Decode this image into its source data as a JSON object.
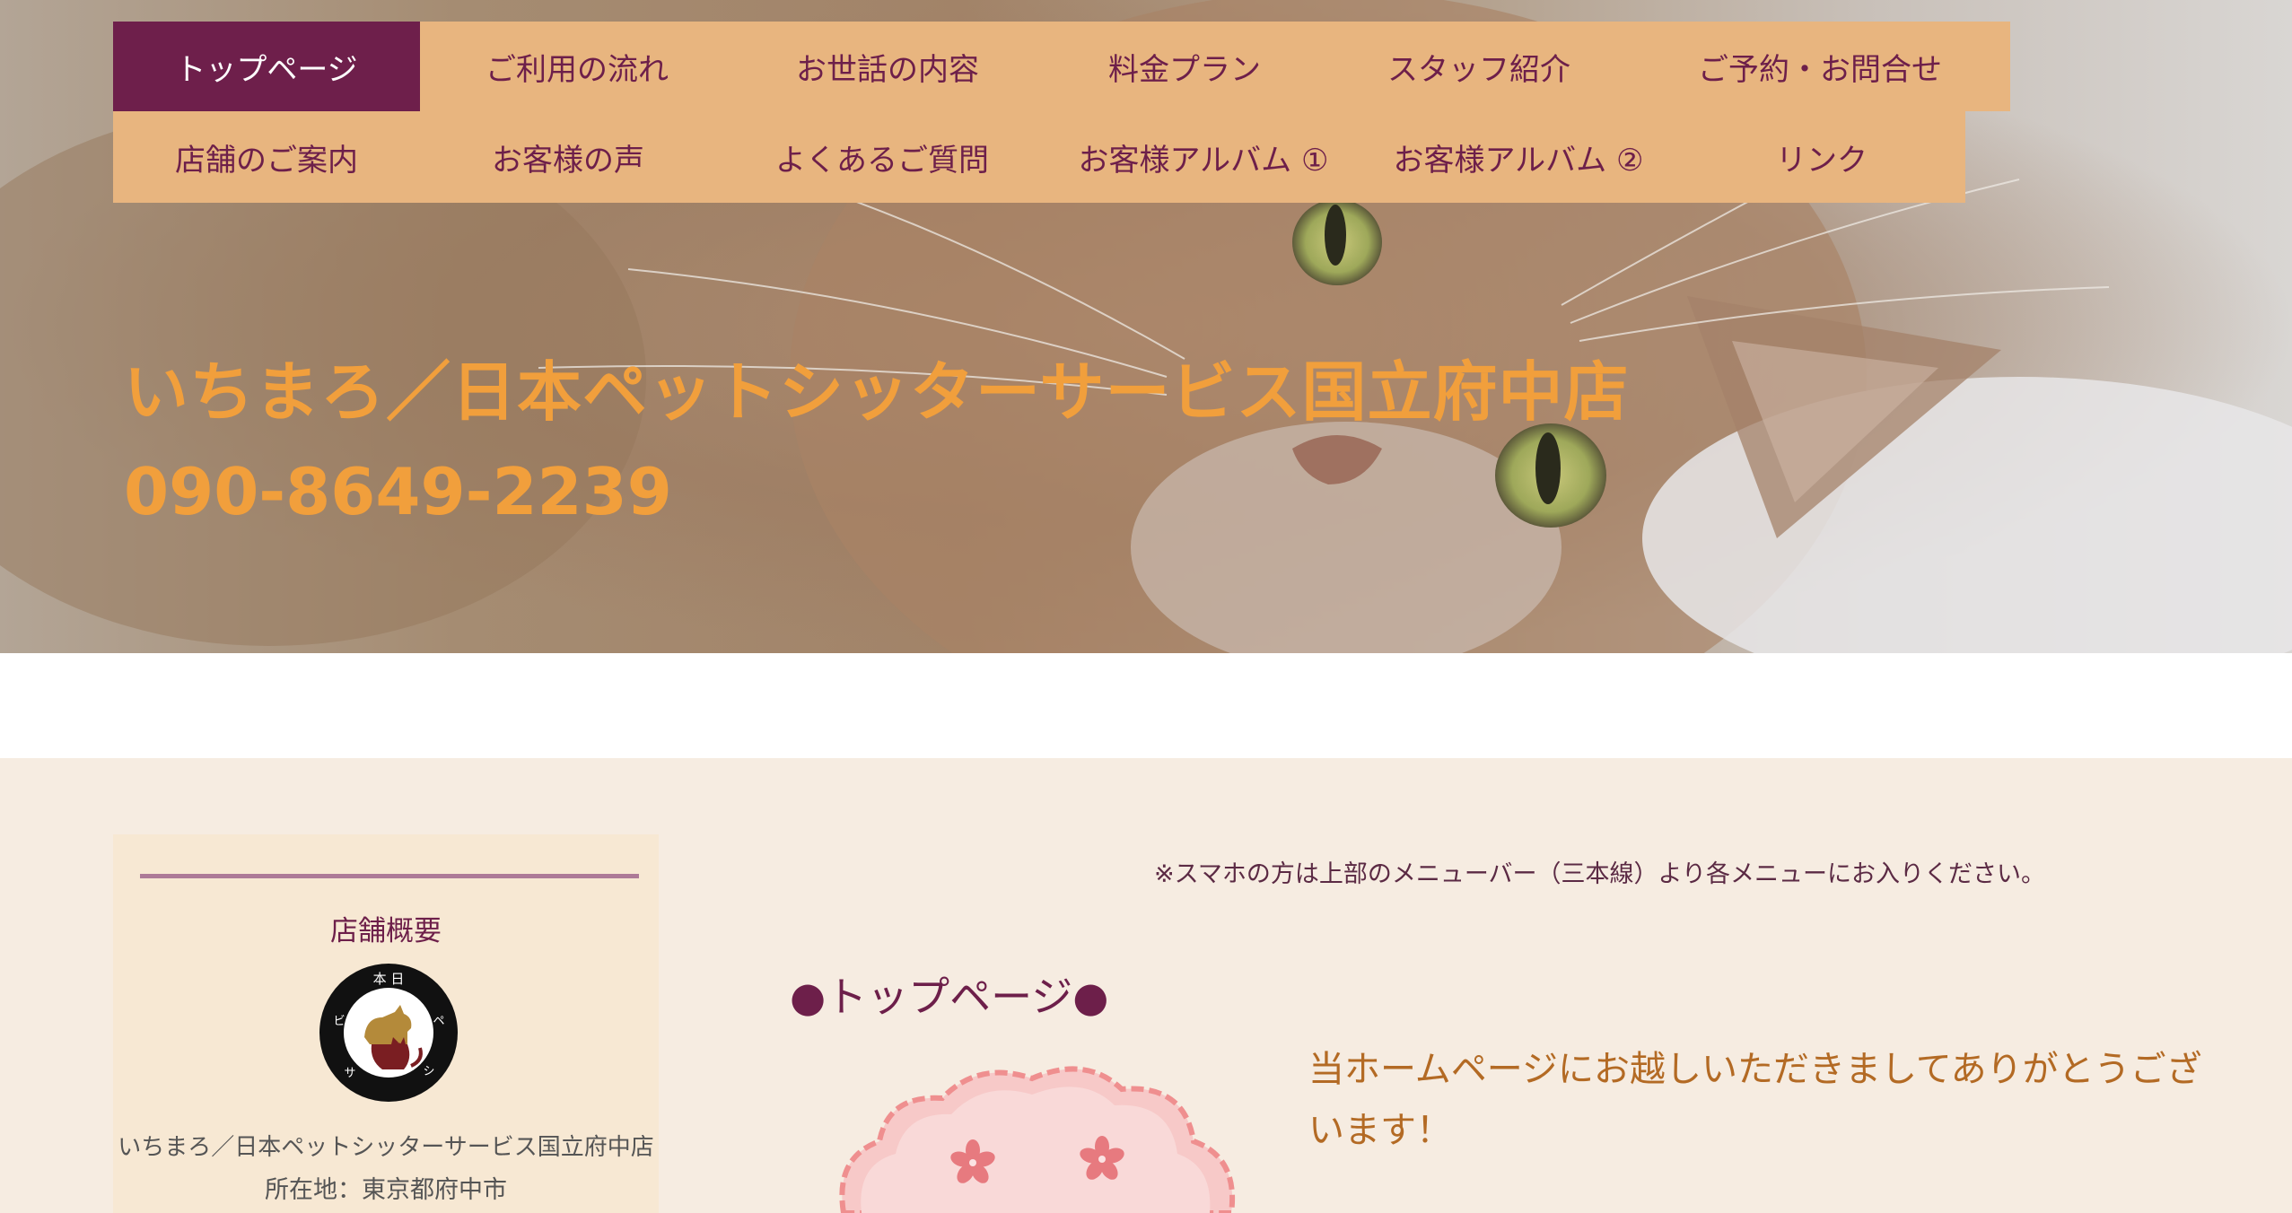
{
  "colors": {
    "nav_bg": "#e8b57f",
    "nav_active_bg": "#6e1f4b",
    "nav_text": "#6d1f4a",
    "title_orange": "#f19f3c",
    "content_bg": "#f6ece1",
    "sidebar_bg": "#f7e8d3",
    "welcome_text": "#b36a24"
  },
  "nav": {
    "row1": [
      {
        "label": "トップページ",
        "active": true
      },
      {
        "label": "ご利用の流れ"
      },
      {
        "label": "お世話の内容"
      },
      {
        "label": "料金プラン"
      },
      {
        "label": "スタッフ紹介"
      },
      {
        "label": "ご予約・お問合せ"
      }
    ],
    "row2": [
      {
        "label": "店舗のご案内"
      },
      {
        "label": "お客様の声"
      },
      {
        "label": "よくあるご質問"
      },
      {
        "label": "お客様アルバム ①"
      },
      {
        "label": "お客様アルバム ②"
      },
      {
        "label": "リンク"
      }
    ]
  },
  "hero": {
    "title": "いちまろ／日本ペットシッターサービス国立府中店",
    "phone": "090-8649-2239",
    "background_image": "cat-photo"
  },
  "sidebar": {
    "heading": "店舗概要",
    "logo_icon": "pet-sitter-logo-icon",
    "logo_text": "日本ペットシッターサービス",
    "store_name": "いちまろ／日本ペットシッターサービス国立府中店",
    "address": "所在地：東京都府中市"
  },
  "main": {
    "notice": "※スマホの方は上部のメニューバー（三本線）より各メニューにお入りください。",
    "page_heading": "●トップページ●",
    "welcome": "当ホームページにお越しいただきましてありがとうございます！",
    "illustration_icon": "sakura-cloud-icon"
  }
}
